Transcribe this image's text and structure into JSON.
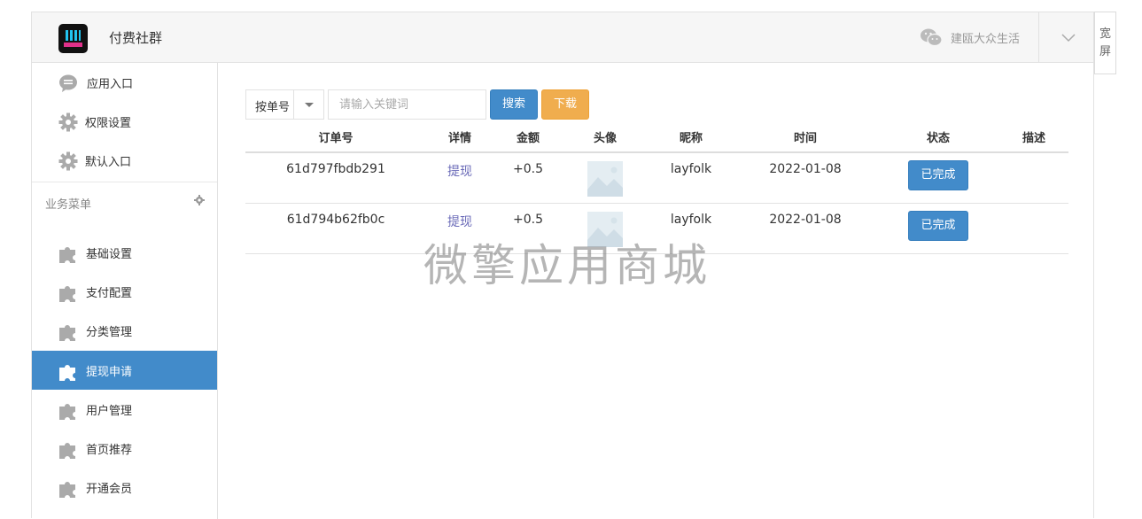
{
  "header": {
    "app_title": "付费社群",
    "account_name": "建瓯大众生活",
    "widescreen_label": [
      "宽",
      "屏"
    ]
  },
  "sidebar": {
    "top_items": [
      {
        "label": "应用入口",
        "icon": "chat-bubble-icon"
      },
      {
        "label": "权限设置",
        "icon": "gear-icon"
      },
      {
        "label": "默认入口",
        "icon": "gear-icon"
      }
    ],
    "section_title": "业务菜单",
    "items": [
      {
        "label": "基础设置",
        "icon": "puzzle-icon"
      },
      {
        "label": "支付配置",
        "icon": "puzzle-icon"
      },
      {
        "label": "分类管理",
        "icon": "puzzle-icon"
      },
      {
        "label": "提现申请",
        "icon": "puzzle-icon",
        "active": true
      },
      {
        "label": "用户管理",
        "icon": "puzzle-icon"
      },
      {
        "label": "首页推荐",
        "icon": "puzzle-icon"
      },
      {
        "label": "开通会员",
        "icon": "puzzle-icon"
      }
    ]
  },
  "filter": {
    "select_value": "按单号",
    "search_placeholder": "请输入关键词",
    "search_label": "搜索",
    "download_label": "下载"
  },
  "table": {
    "headers": [
      "订单号",
      "详情",
      "金额",
      "头像",
      "昵称",
      "时间",
      "状态",
      "描述"
    ],
    "rows": [
      {
        "order_no": "61d797fbdb291",
        "detail": "提现",
        "amount": "+0.5",
        "nickname": "layfolk",
        "time": "2022-01-08",
        "status": "已完成",
        "desc": ""
      },
      {
        "order_no": "61d794b62fb0c",
        "detail": "提现",
        "amount": "+0.5",
        "nickname": "layfolk",
        "time": "2022-01-08",
        "status": "已完成",
        "desc": ""
      }
    ]
  },
  "watermark": "微擎应用商城",
  "colors": {
    "primary": "#428bca",
    "warning": "#f0ad4e",
    "link": "#6a6ab8"
  }
}
